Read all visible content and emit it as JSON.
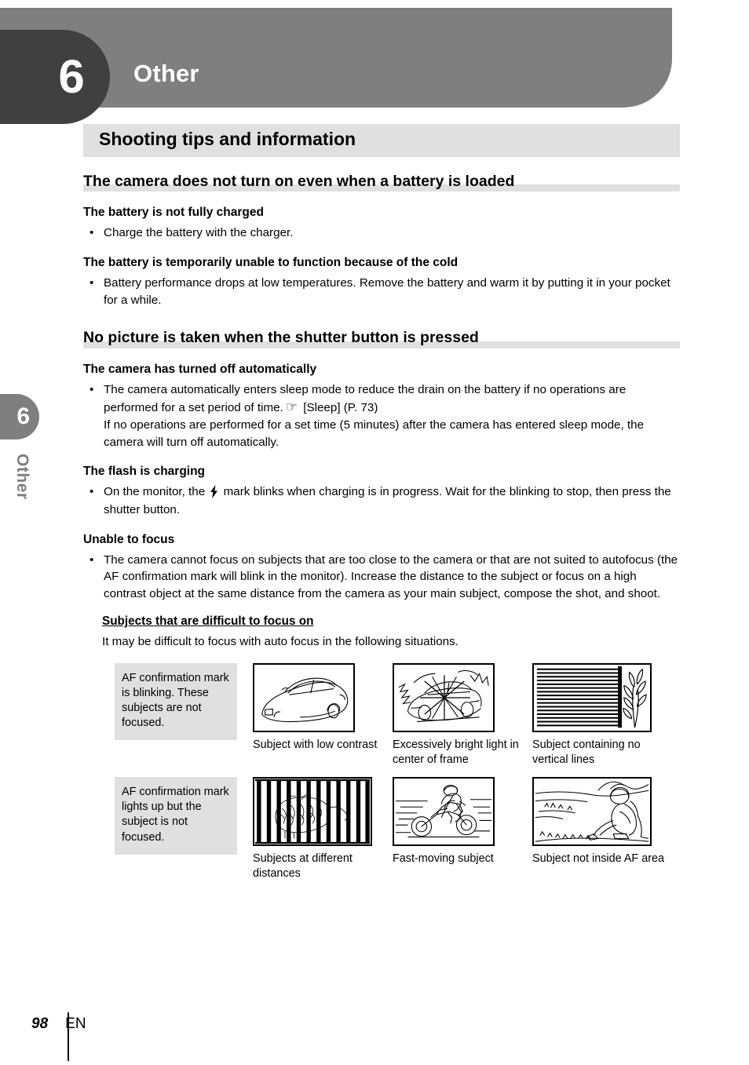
{
  "chapter": {
    "number": "6",
    "title": "Other",
    "side_tab_number": "6",
    "side_tab_label": "Other"
  },
  "section": {
    "band_title": "Shooting tips and information"
  },
  "topics": [
    {
      "heading": "The camera does not turn on even when a battery is loaded",
      "groups": [
        {
          "subheading": "The battery is not fully charged",
          "bullets": [
            "Charge the battery with the charger."
          ]
        },
        {
          "subheading": "The battery is temporarily unable to function because of the cold",
          "bullets": [
            "Battery performance drops at low temperatures. Remove the battery and warm it by putting it in your pocket for a while."
          ]
        }
      ]
    },
    {
      "heading": "No picture is taken when the shutter button is pressed",
      "groups": [
        {
          "subheading": "The camera has turned off automatically",
          "bullet_pre": "The camera automatically enters sleep mode to reduce the drain on the battery if no operations are performed for a set period of time.",
          "bullet_ref": "[Sleep] (P. 73)",
          "bullet_post": "If no operations are performed for a set time (5 minutes) after the camera has entered sleep mode, the camera will turn off automatically."
        },
        {
          "subheading": "The flash is charging",
          "bullet_pre": "On the monitor, the",
          "bullet_post": "mark blinks when charging is in progress. Wait for the blinking to stop, then press the shutter button."
        },
        {
          "subheading": "Unable to focus",
          "bullets": [
            "The camera cannot focus on subjects that are too close to the camera or that are not suited to autofocus (the AF confirmation mark will blink in the monitor). Increase the distance to the subject or focus on a high contrast object at the same distance from the camera as your main subject, compose the shot, and shoot."
          ]
        }
      ]
    }
  ],
  "subsection": {
    "heading": "Subjects that are difficult to focus on",
    "intro": "It may be difficult to focus with auto focus in the following situations."
  },
  "figure_rows": [
    {
      "note": "AF confirmation mark is blinking. These subjects are not focused.",
      "figures": [
        {
          "icon": "car-low-contrast-illustration",
          "caption": "Subject with low contrast"
        },
        {
          "icon": "bright-light-car-illustration",
          "caption": "Excessively bright light in center of frame"
        },
        {
          "icon": "horizontal-blinds-plant-illustration",
          "caption": "Subject containing no vertical lines"
        }
      ]
    },
    {
      "note": "AF confirmation mark lights up but the subject is not focused.",
      "figures": [
        {
          "icon": "animal-behind-bars-illustration",
          "caption": "Subjects at different distances"
        },
        {
          "icon": "motorcycle-rider-illustration",
          "caption": "Fast-moving subject"
        },
        {
          "icon": "person-in-landscape-illustration",
          "caption": "Subject not inside AF area"
        }
      ]
    }
  ],
  "icons": {
    "pointing_hand": "☞",
    "flash_bolt": "⚡"
  },
  "footer": {
    "page_number": "98",
    "language": "EN"
  },
  "colors": {
    "band_gray": "#7f7f7f",
    "chapter_box_dark": "#404040",
    "light_gray": "#e0e0e0"
  }
}
